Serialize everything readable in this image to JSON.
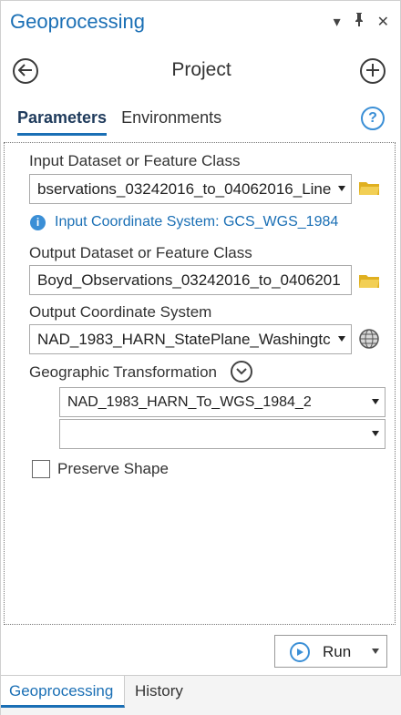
{
  "window": {
    "title": "Geoprocessing",
    "icons": [
      "menu-dropdown-icon",
      "pin-icon",
      "close-icon"
    ]
  },
  "header": {
    "title": "Project",
    "back_icon": "arrow-left-icon",
    "add_icon": "plus-icon"
  },
  "tabs": [
    {
      "label": "Parameters",
      "active": true
    },
    {
      "label": "Environments",
      "active": false
    }
  ],
  "help_label": "?",
  "form": {
    "input_dataset": {
      "label": "Input Dataset or Feature Class",
      "value": "bservations_03242016_to_04062016_Line"
    },
    "input_coord_info": "Input Coordinate System: GCS_WGS_1984",
    "output_dataset": {
      "label": "Output Dataset or Feature Class",
      "value": "Boyd_Observations_03242016_to_0406201"
    },
    "output_coord": {
      "label": "Output Coordinate System",
      "value": "NAD_1983_HARN_StatePlane_Washingtc"
    },
    "geo_transform": {
      "label": "Geographic Transformation",
      "value_1": "NAD_1983_HARN_To_WGS_1984_2",
      "value_2": ""
    },
    "preserve_shape": {
      "label": "Preserve Shape",
      "checked": false
    }
  },
  "run_button": {
    "label": "Run"
  },
  "bottom_tabs": [
    {
      "label": "Geoprocessing",
      "active": true
    },
    {
      "label": "History",
      "active": false
    }
  ],
  "colors": {
    "accent": "#1a6fb5",
    "folder": "#e0b020",
    "info": "#3b8fd6"
  }
}
